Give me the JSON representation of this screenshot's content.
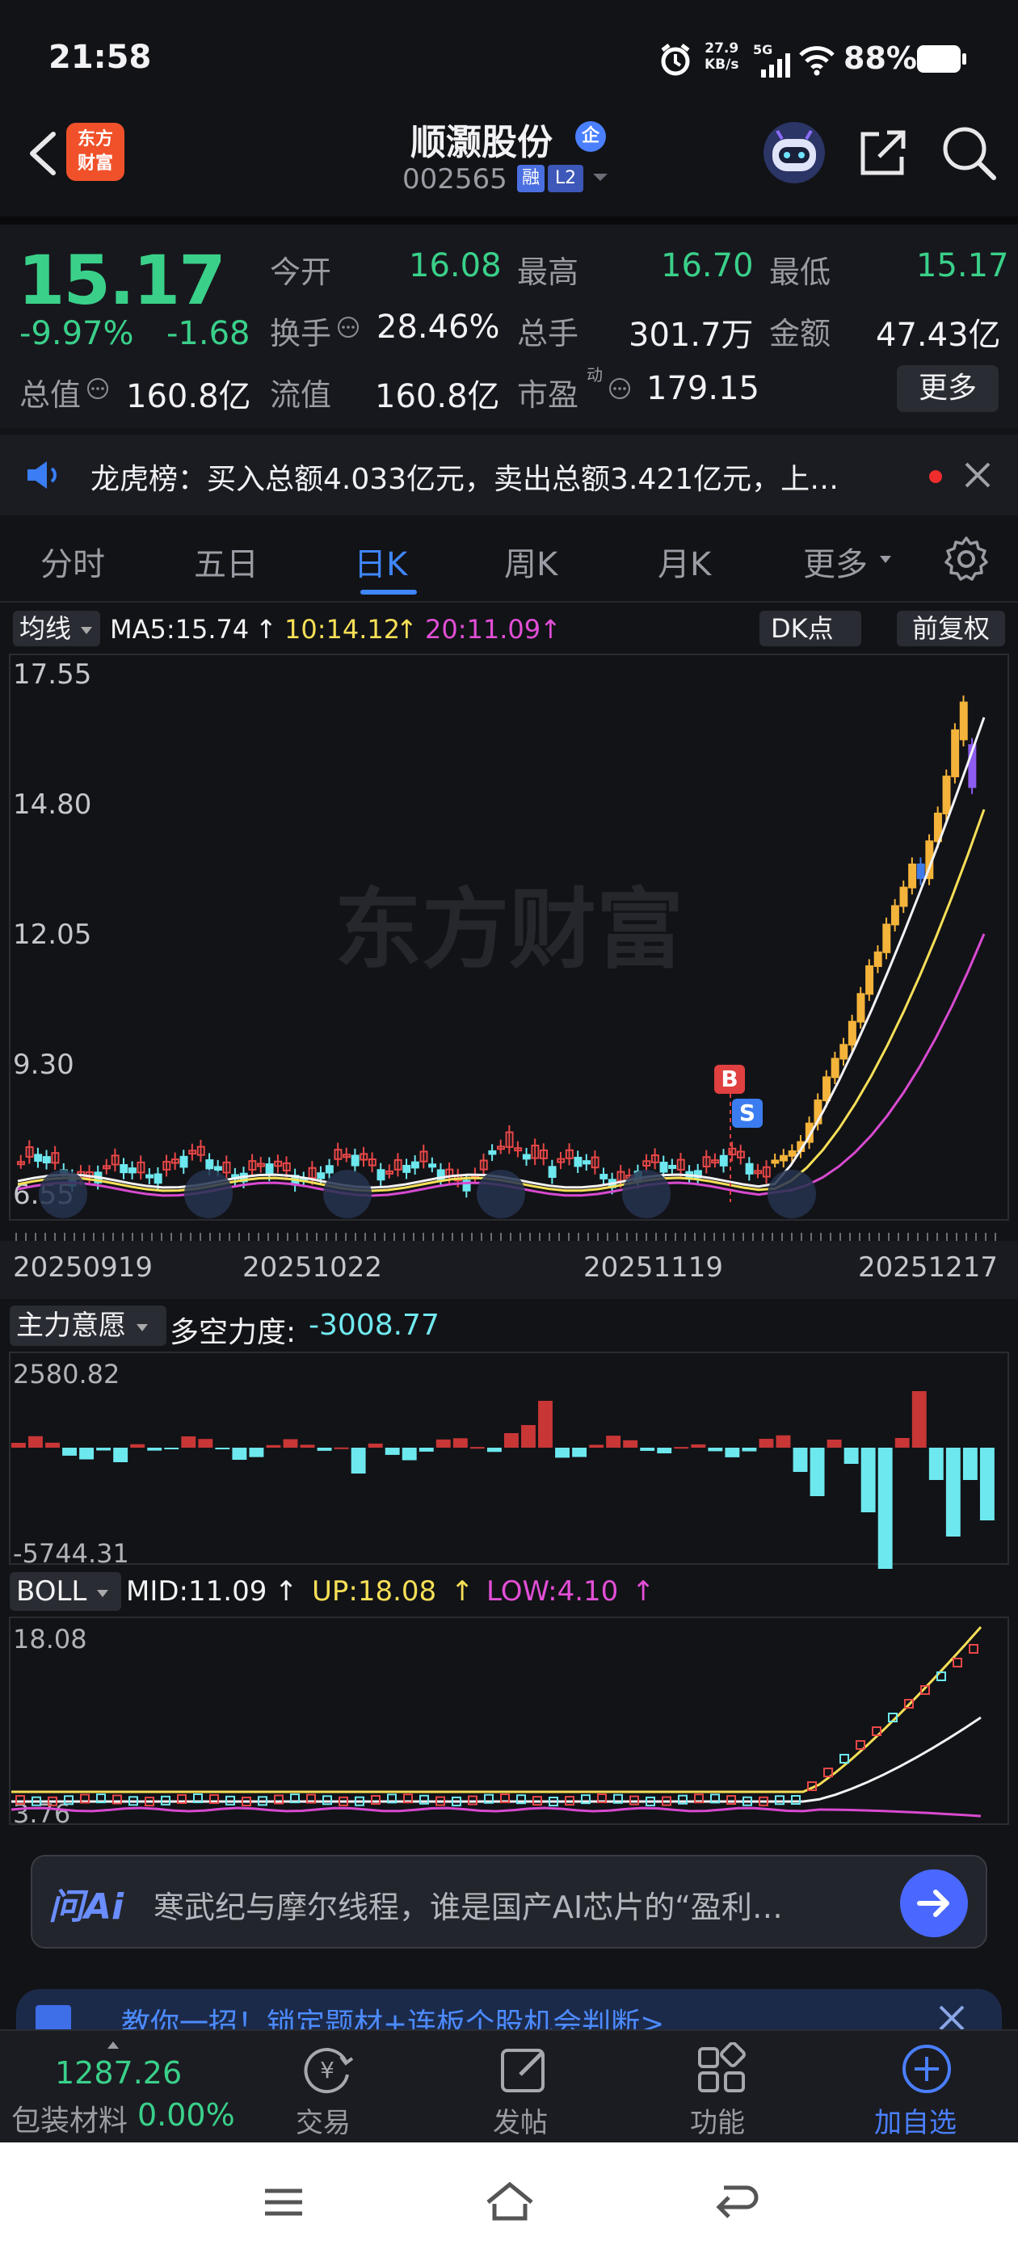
{
  "status_bar": {
    "time": "21:58",
    "net_speed_top": "27.9",
    "net_speed_bottom": "KB/s",
    "net_type": "5G",
    "battery": "88%"
  },
  "header": {
    "logo_text_1": "东方",
    "logo_text_2": "财富",
    "title": "顺灏股份",
    "corp_badge": "企",
    "code": "002565",
    "margin_badge": "融",
    "level_badge": "L2"
  },
  "quote": {
    "price": "15.17",
    "change_pct": "-9.97%",
    "change": "-1.68",
    "open_label": "今开",
    "open": "16.08",
    "high_label": "最高",
    "high": "16.70",
    "low_label": "最低",
    "low": "15.17",
    "turnover_label": "换手",
    "turnover": "28.46%",
    "volume_label": "总手",
    "volume": "301.7万",
    "amount_label": "金额",
    "amount": "47.43亿",
    "total_cap_label": "总值",
    "total_cap": "160.8亿",
    "float_cap_label": "流值",
    "float_cap": "160.8亿",
    "pe_label": "市盈",
    "pe_sup": "动",
    "pe": "179.15",
    "more_button": "更多"
  },
  "notice": {
    "text": "龙虎榜：买入总额4.033亿元，卖出总额3.421亿元，上…"
  },
  "tabs": [
    {
      "label": "分时"
    },
    {
      "label": "五日"
    },
    {
      "label": "日K"
    },
    {
      "label": "周K"
    },
    {
      "label": "月K"
    },
    {
      "label": "更多"
    }
  ],
  "kline": {
    "indicator_select": "均线",
    "ma5": "MA5:15.74",
    "ma10": "10:14.12",
    "ma20": "20:11.09",
    "dk_button": "DK点",
    "fq_button": "前复权",
    "watermark": "东方财富",
    "y_labels": [
      "17.55",
      "14.80",
      "12.05",
      "9.30",
      "6.55"
    ],
    "x_labels": [
      "20250919",
      "20251022",
      "20251119",
      "20251217"
    ],
    "buy_marker": "B",
    "sell_marker": "S"
  },
  "capital": {
    "select": "主力意愿",
    "label": "多空力度:",
    "value": "-3008.77",
    "y_top": "2580.82",
    "y_bottom": "-5744.31"
  },
  "boll": {
    "select": "BOLL",
    "mid": "MID:11.09",
    "up": "UP:18.08",
    "low": "LOW:4.10",
    "y_top": "18.08",
    "y_bottom": "3.76"
  },
  "ai_bar": {
    "brand": "问Ai",
    "text": "寒武纪与摩尔线程，谁是国产AI芯片的“盈利…"
  },
  "promo": {
    "text": "教你一招！锁定题材+连板个股机会判断>"
  },
  "bottom_nav": {
    "sector_value": "1287.26",
    "sector_name": "包装材料",
    "sector_change": "0.00%",
    "items": [
      {
        "label": "交易"
      },
      {
        "label": "发帖"
      },
      {
        "label": "功能"
      },
      {
        "label": "加自选"
      }
    ]
  },
  "colors": {
    "up": "#f04848",
    "down": "#3ad08a",
    "accent": "#4a8cff",
    "bg": "#121317"
  }
}
